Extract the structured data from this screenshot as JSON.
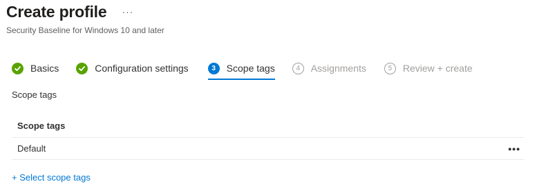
{
  "header": {
    "title": "Create profile",
    "more_glyph": "···",
    "subtitle": "Security Baseline for Windows 10 and later"
  },
  "wizard": {
    "steps": [
      {
        "number": "1",
        "label": "Basics",
        "state": "done",
        "icon": "checkmark-icon"
      },
      {
        "number": "2",
        "label": "Configuration settings",
        "state": "done",
        "icon": "checkmark-icon"
      },
      {
        "number": "3",
        "label": "Scope tags",
        "state": "active"
      },
      {
        "number": "4",
        "label": "Assignments",
        "state": "future"
      },
      {
        "number": "5",
        "label": "Review + create",
        "state": "future"
      }
    ]
  },
  "scope_tags": {
    "section_label": "Scope tags",
    "column_header": "Scope tags",
    "rows": [
      {
        "name": "Default",
        "more_glyph": "•••"
      }
    ],
    "add_link": "+ Select scope tags"
  },
  "colors": {
    "accent": "#0078d4",
    "success": "#57a300",
    "disabled": "#a19f9d"
  }
}
